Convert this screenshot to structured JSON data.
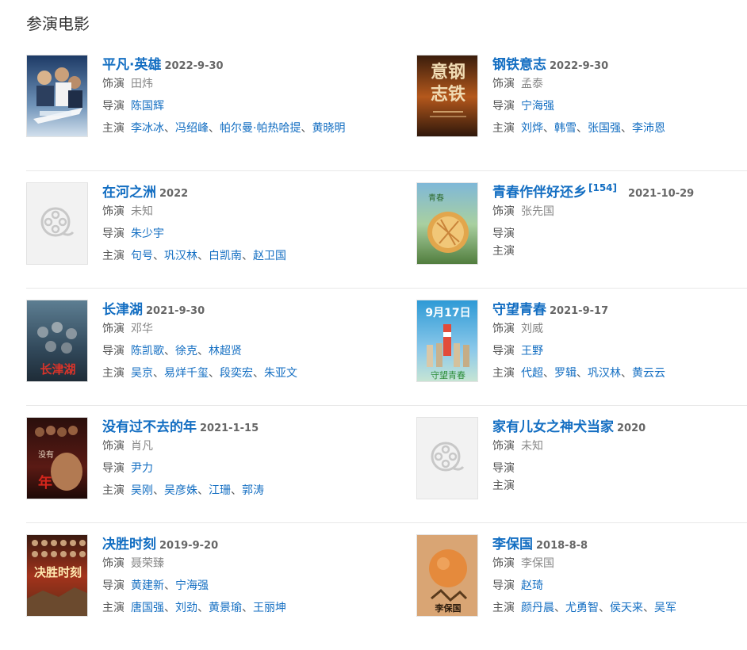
{
  "section_title": "参演电影",
  "labels": {
    "role": "饰演",
    "director": "导演",
    "starring": "主演",
    "sep": "、"
  },
  "films": [
    {
      "title": "平凡·英雄",
      "date": "2022-9-30",
      "role": "田炜",
      "directors": [
        "陈国辉"
      ],
      "stars": [
        "李冰冰",
        "冯绍峰",
        "帕尔曼·帕热哈提",
        "黄晓明"
      ]
    },
    {
      "title": "钢铁意志",
      "date": "2022-9-30",
      "role": "孟泰",
      "directors": [
        "宁海强"
      ],
      "stars": [
        "刘烨",
        "韩雪",
        "张国强",
        "李沛恩"
      ],
      "poster_text": "意钢志铁"
    },
    {
      "title": "在河之洲",
      "date": "2022",
      "role": "未知",
      "directors": [
        "朱少宇"
      ],
      "stars": [
        "句号",
        "巩汉林",
        "白凯南",
        "赵卫国"
      ]
    },
    {
      "title": "青春作伴好还乡",
      "cite": "[154]",
      "date": "2021-10-29",
      "role": "张先国",
      "directors": [],
      "stars": []
    },
    {
      "title": "长津湖",
      "date": "2021-9-30",
      "role": "邓华",
      "directors": [
        "陈凯歌",
        "徐克",
        "林超贤"
      ],
      "stars": [
        "吴京",
        "易烊千玺",
        "段奕宏",
        "朱亚文"
      ],
      "poster_text": "长津湖"
    },
    {
      "title": "守望青春",
      "date": "2021-9-17",
      "role": "刘威",
      "directors": [
        "王野"
      ],
      "stars": [
        "代超",
        "罗辑",
        "巩汉林",
        "黄云云"
      ],
      "poster_text": "9月17日"
    },
    {
      "title": "没有过不去的年",
      "date": "2021-1-15",
      "role": "肖凡",
      "directors": [
        "尹力"
      ],
      "stars": [
        "吴刚",
        "吴彦姝",
        "江珊",
        "郭涛"
      ]
    },
    {
      "title": "家有儿女之神犬当家",
      "date": "2020",
      "role": "未知",
      "directors": [],
      "stars": []
    },
    {
      "title": "决胜时刻",
      "date": "2019-9-20",
      "role": "聂荣臻",
      "directors": [
        "黄建新",
        "宁海强"
      ],
      "stars": [
        "唐国强",
        "刘劲",
        "黄景瑜",
        "王丽坤"
      ],
      "poster_text": "决胜时刻"
    },
    {
      "title": "李保国",
      "date": "2018-8-8",
      "role": "李保国",
      "directors": [
        "赵琦"
      ],
      "stars": [
        "颜丹晨",
        "尤勇智",
        "侯天来",
        "吴军"
      ],
      "poster_text": "李保国"
    }
  ]
}
